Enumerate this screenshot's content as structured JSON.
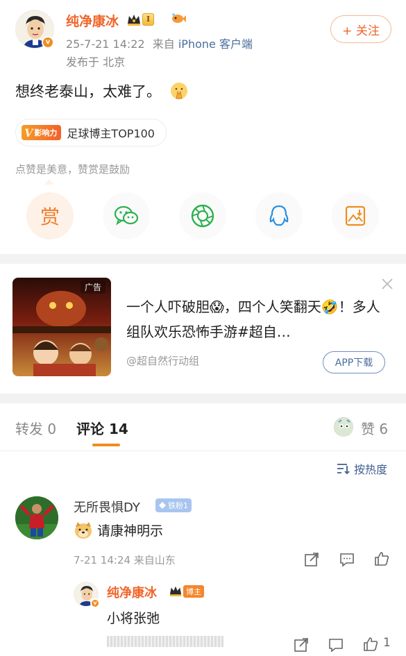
{
  "post": {
    "author": "纯净康冰",
    "level": "I",
    "timestamp": "25-7-21 14:22",
    "source_prefix": "来自",
    "source": "iPhone 客户端",
    "location": "发布于 北京",
    "follow_label": "+ 关注",
    "text": "想终老泰山，太难了。",
    "influence_badge": "影响力",
    "tag_text": "足球博主TOP100",
    "reward_tip": "点赞是美意，赞赏是鼓励",
    "reward_glyph": "赏"
  },
  "share_icons": [
    "reward-icon",
    "wechat-icon",
    "moments-icon",
    "qq-icon",
    "save-image-icon"
  ],
  "ad": {
    "label": "广告",
    "text": "一个人吓破胆😱，四个人笑翻天🤣！多人组队欢乐恐怖手游#超自…",
    "source": "@超自然行动组",
    "button": "APP下载"
  },
  "tabs": {
    "repost": "转发 0",
    "comment": "评论 14",
    "like": "赞 6"
  },
  "sort_label": "按热度",
  "comments": [
    {
      "name": "无所畏惧DY",
      "badge": "铁粉1",
      "text": "请康神明示",
      "meta": "7-21 14:24  来自山东"
    }
  ],
  "reply": {
    "name": "纯净康冰",
    "badge": "博主",
    "text": "小将张弛",
    "like_count": "1"
  },
  "colors": {
    "accent": "#f0652a",
    "link": "#4a6d9c",
    "tab_underline": "#f08d1e"
  }
}
